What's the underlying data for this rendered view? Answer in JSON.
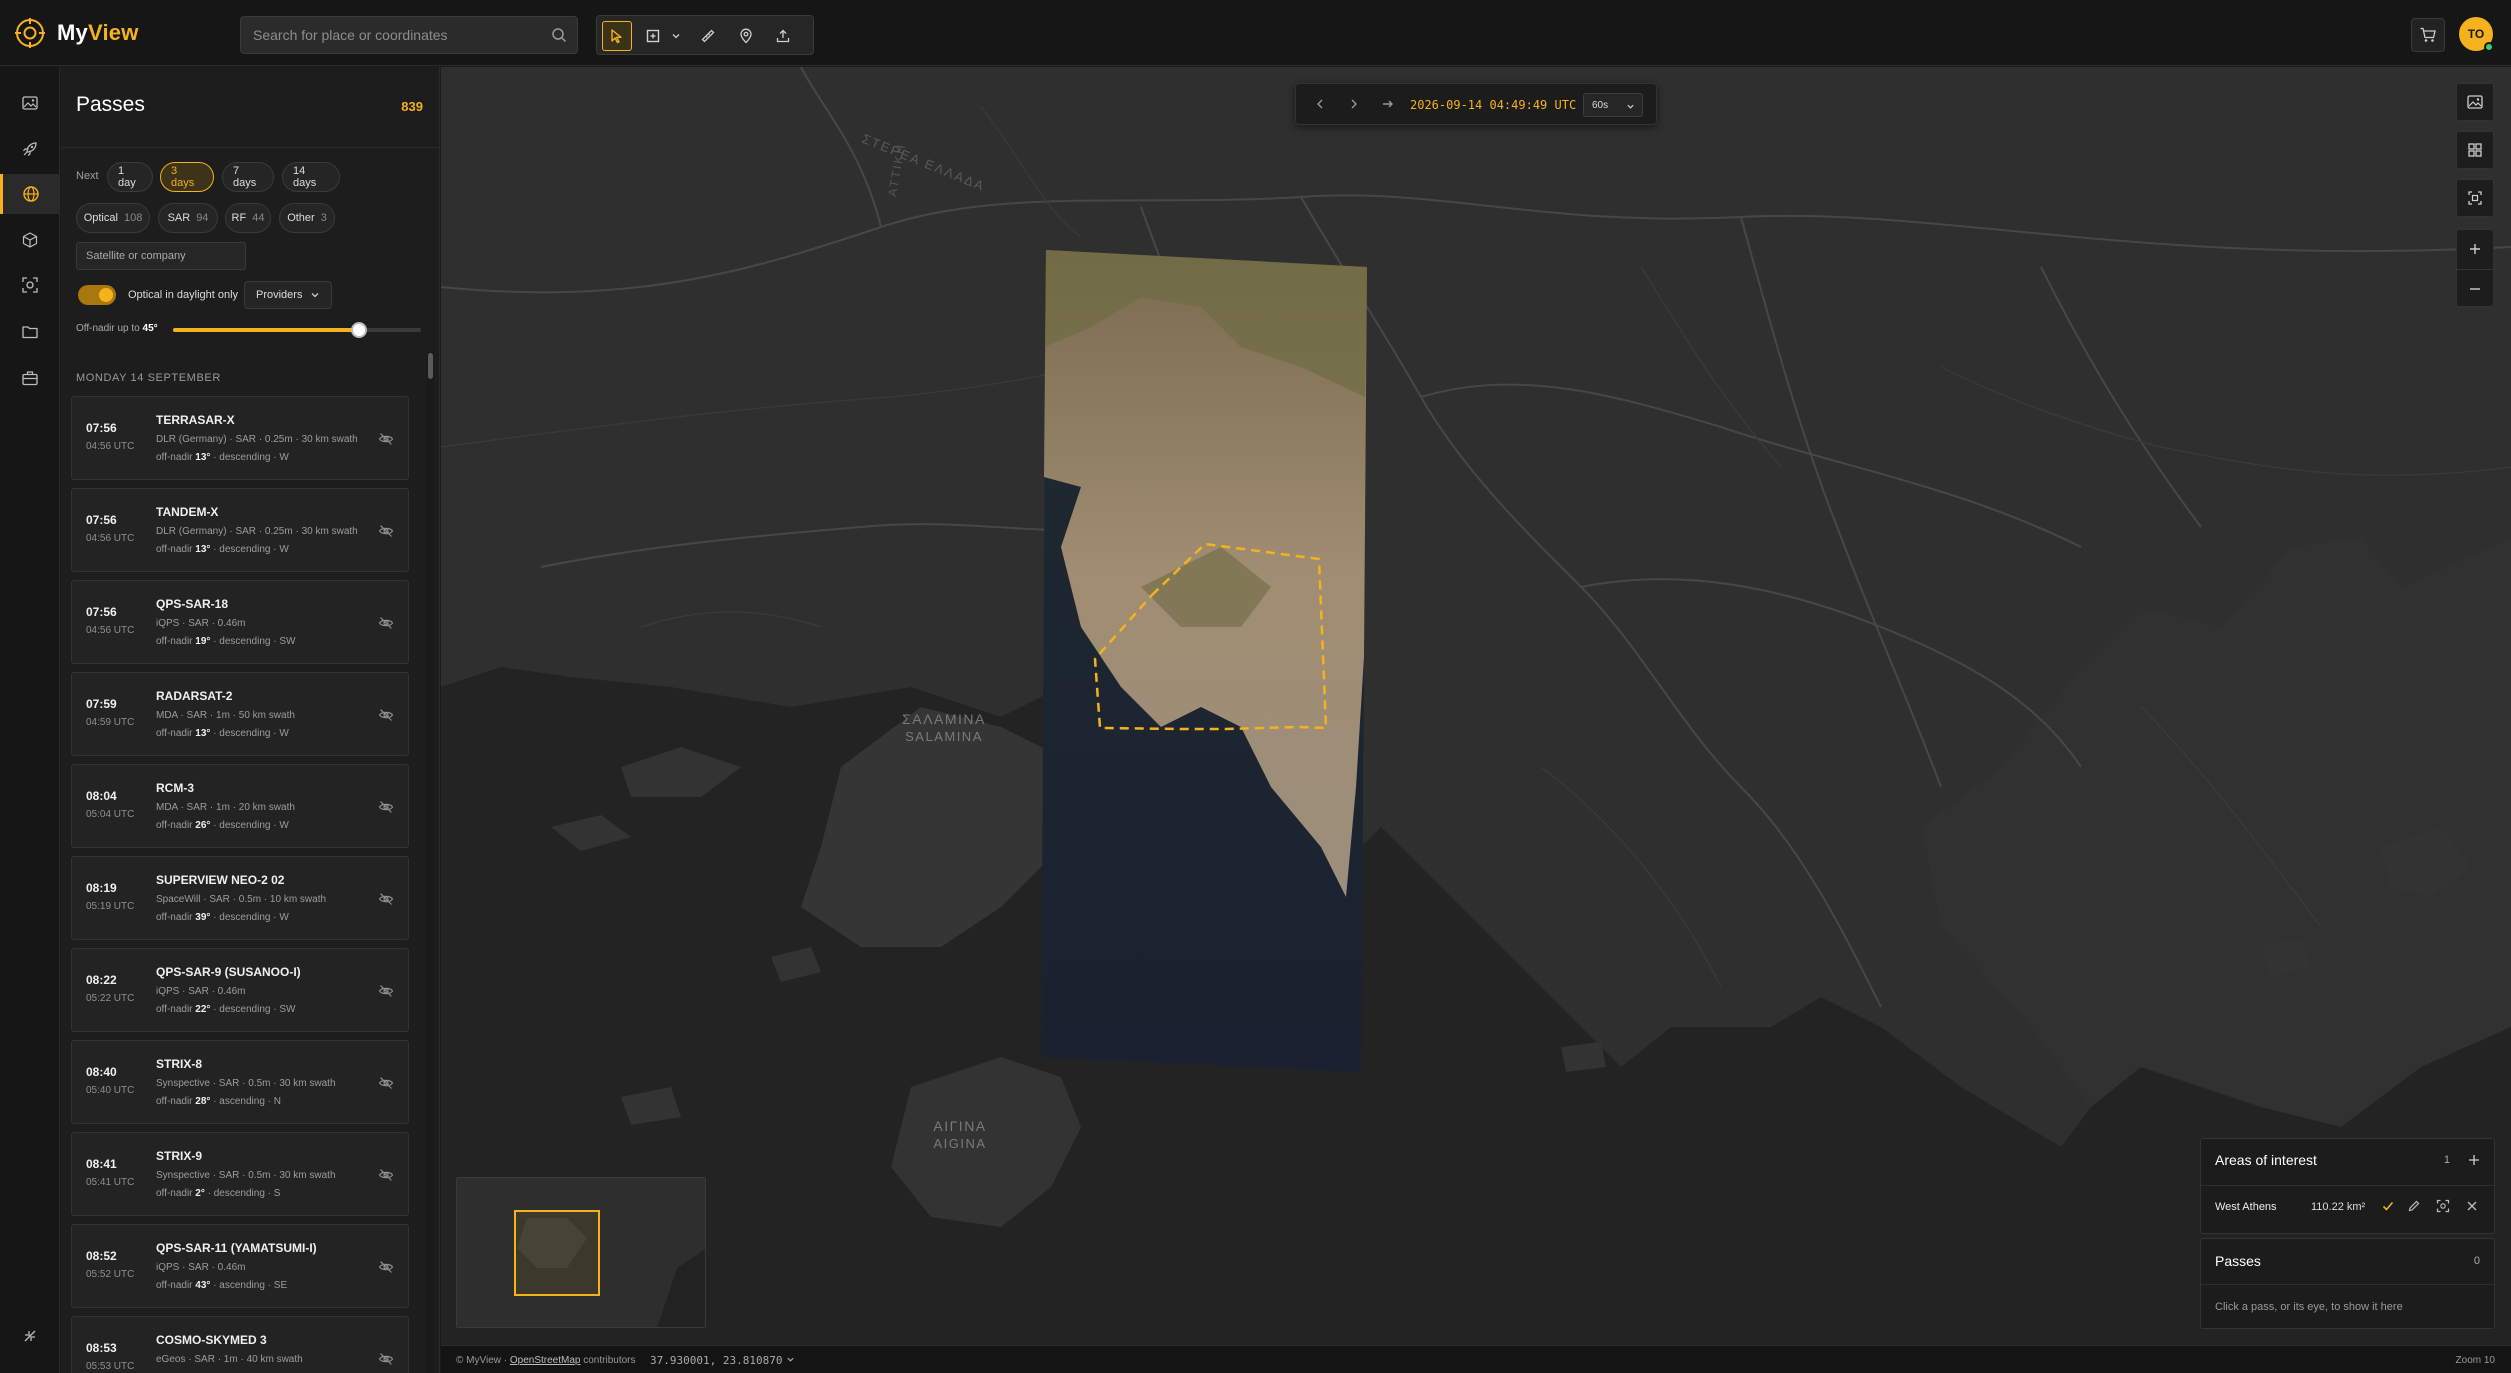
{
  "app": {
    "brand_my": "My",
    "brand_view": "View",
    "accent": "#f5b21c"
  },
  "search": {
    "placeholder": "Search for place or coordinates"
  },
  "toolbar": {
    "tools": [
      "select-tool",
      "area-draw-tool",
      "measure-tool",
      "pin-tool",
      "upload-tool"
    ]
  },
  "user": {
    "initials": "TO"
  },
  "passes": {
    "title": "Passes",
    "count": "839",
    "next_label": "Next",
    "ranges": [
      "1 day",
      "3 days",
      "7 days",
      "14 days"
    ],
    "active_range": "3 days",
    "types": [
      {
        "label": "Optical",
        "count": "108"
      },
      {
        "label": "SAR",
        "count": "94"
      },
      {
        "label": "RF",
        "count": "44"
      },
      {
        "label": "Other",
        "count": "3"
      }
    ],
    "sat_placeholder": "Satellite or company",
    "daylight_label": "Optical in daylight only",
    "daylight_on": true,
    "providers_label": "Providers",
    "offnadir_prefix": "Off-nadir up to",
    "offnadir_value": "45°",
    "offnadir_fraction": 0.75,
    "day_header": "MONDAY 14 SEPTEMBER",
    "items": [
      {
        "local": "07:56",
        "utc": "04:56 UTC",
        "name": "TERRASAR-X",
        "details": "DLR (Germany) · SAR · 0.25m · 30 km swath",
        "offnadir": "13°",
        "dir": " · descending · W"
      },
      {
        "local": "07:56",
        "utc": "04:56 UTC",
        "name": "TANDEM-X",
        "details": "DLR (Germany) · SAR · 0.25m · 30 km swath",
        "offnadir": "13°",
        "dir": " · descending · W"
      },
      {
        "local": "07:56",
        "utc": "04:56 UTC",
        "name": "QPS-SAR-18",
        "details": "iQPS · SAR · 0.46m",
        "offnadir": "19°",
        "dir": " · descending · SW"
      },
      {
        "local": "07:59",
        "utc": "04:59 UTC",
        "name": "RADARSAT-2",
        "details": "MDA · SAR · 1m · 50 km swath",
        "offnadir": "13°",
        "dir": " · descending · W"
      },
      {
        "local": "08:04",
        "utc": "05:04 UTC",
        "name": "RCM-3",
        "details": "MDA · SAR · 1m · 20 km swath",
        "offnadir": "26°",
        "dir": " · descending · W"
      },
      {
        "local": "08:19",
        "utc": "05:19 UTC",
        "name": "SUPERVIEW NEO-2 02",
        "details": "SpaceWill · SAR · 0.5m · 10 km swath",
        "offnadir": "39°",
        "dir": " · descending · W"
      },
      {
        "local": "08:22",
        "utc": "05:22 UTC",
        "name": "QPS-SAR-9 (SUSANOO-I)",
        "details": "iQPS · SAR · 0.46m",
        "offnadir": "22°",
        "dir": " · descending · SW"
      },
      {
        "local": "08:40",
        "utc": "05:40 UTC",
        "name": "STRIX-8",
        "details": "Synspective · SAR · 0.5m · 30 km swath",
        "offnadir": "28°",
        "dir": " · ascending · N"
      },
      {
        "local": "08:41",
        "utc": "05:41 UTC",
        "name": "STRIX-9",
        "details": "Synspective · SAR · 0.5m · 30 km swath",
        "offnadir": "2°",
        "dir": " · descending · S"
      },
      {
        "local": "08:52",
        "utc": "05:52 UTC",
        "name": "QPS-SAR-11 (YAMATSUMI-I)",
        "details": "iQPS · SAR · 0.46m",
        "offnadir": "43°",
        "dir": " · ascending · SE"
      },
      {
        "local": "08:53",
        "utc": "05:53 UTC",
        "name": "COSMO-SKYMED 3",
        "details": "eGeos · SAR · 1m · 40 km swath",
        "offnadir": "",
        "dir": ""
      }
    ],
    "offnadir_word": "off-nadir"
  },
  "map": {
    "time": "2026-09-14 04:49:49 UTC",
    "step": "60s",
    "labels": {
      "stereaellada": "ΣΤΕΡΕΑ ΕΛΛΑΔΑ",
      "attiki": "ΑΤΤΙΚΗ",
      "salamina_gr": "ΣΑΛΑΜΙΝΑ",
      "salamina_lat": "SALAMINA",
      "aigina_gr": "ΑΙΓΙΝΑ",
      "aigina_lat": "AIGINA"
    }
  },
  "aoi": {
    "title": "Areas of interest",
    "count": "1",
    "items": [
      {
        "name": "West Athens",
        "area": "110.22 km²"
      }
    ]
  },
  "passes_box": {
    "title": "Passes",
    "count": "0",
    "hint": "Click a pass, or its eye, to show it here"
  },
  "status": {
    "attribution_prefix": "© MyView · ",
    "attribution_link": "OpenStreetMap",
    "attribution_suffix": " contributors",
    "coords": "37.930001, 23.810870",
    "zoom": "Zoom 10"
  }
}
